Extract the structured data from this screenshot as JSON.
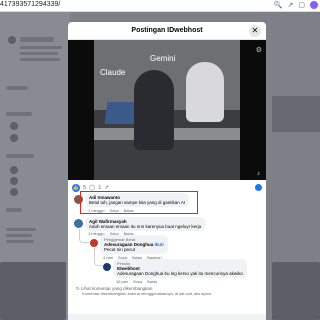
{
  "browser": {
    "url": "417393571294339/",
    "icons": [
      "search-icon",
      "share-icon",
      "tabs-icon",
      "profile-icon"
    ]
  },
  "modal": {
    "title": "Postingan IDwebhost",
    "close_icon": "close-icon"
  },
  "media": {
    "labels": [
      "Claude",
      "Gemini"
    ]
  },
  "reactions": {
    "like_count": "5",
    "comment_count": "1"
  },
  "comments": [
    {
      "name": "Adi Irmawanto",
      "text": "Betul tuh, jangan sampe kita yang di gantikan AI",
      "meta": [
        "1 minggu",
        "Suka",
        "Balas"
      ]
    },
    {
      "name": "Agil Wafirmasyah",
      "text": "Aduh emaan emaan itu nnn karenyua buat ngeluyr kerja",
      "meta": [
        "1 minggu",
        "Suka",
        "Balas"
      ]
    },
    {
      "tag": "Penggemar Berat",
      "name": "Adesuragaan Donghua",
      "badge": "Ikuti",
      "text": "Pecut nin pecut",
      "meta": [
        "4 hari",
        "Suka",
        "Balas",
        "Bagikan"
      ]
    },
    {
      "tag": "Penulis",
      "name": "IDwebhost",
      "text": "Adesuragaan Donghua bu lng kerso yak itu mencurinya akwiko",
      "meta": [
        "16 jam",
        "Suka",
        "Balas"
      ]
    }
  ],
  "more_comments": {
    "label": "Lihat komentar yang dikembangkan",
    "desc": "Komentar dikembangkan karena menggunakannya, di kat cuit, alis ayam."
  }
}
